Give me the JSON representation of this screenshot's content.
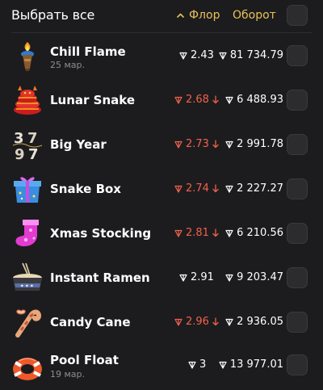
{
  "header": {
    "select_all_label": "Выбрать все",
    "sort_floor_label": "Флор",
    "sort_volume_label": "Оборот"
  },
  "colors": {
    "background": "#1c1c1e",
    "accent": "#e7c15a",
    "down": "#f0614b",
    "text": "#ffffff",
    "muted": "#8e8e93"
  },
  "rows": [
    {
      "name": "Chill Flame",
      "date": "25 мар.",
      "floor": "2.43",
      "floor_trend": "none",
      "volume": "81 734.79",
      "icon": "chill-flame-icon"
    },
    {
      "name": "Lunar Snake",
      "date": "",
      "floor": "2.68",
      "floor_trend": "down",
      "volume": "6 488.93",
      "icon": "lunar-snake-icon"
    },
    {
      "name": "Big Year",
      "date": "",
      "floor": "2.73",
      "floor_trend": "down",
      "volume": "2 991.78",
      "icon": "big-year-icon"
    },
    {
      "name": "Snake Box",
      "date": "",
      "floor": "2.74",
      "floor_trend": "down",
      "volume": "2 227.27",
      "icon": "snake-box-icon"
    },
    {
      "name": "Xmas Stocking",
      "date": "",
      "floor": "2.81",
      "floor_trend": "down",
      "volume": "6 210.56",
      "icon": "xmas-stocking-icon"
    },
    {
      "name": "Instant Ramen",
      "date": "",
      "floor": "2.91",
      "floor_trend": "none",
      "volume": "9 203.47",
      "icon": "instant-ramen-icon"
    },
    {
      "name": "Candy Cane",
      "date": "",
      "floor": "2.96",
      "floor_trend": "down",
      "volume": "2 936.05",
      "icon": "candy-cane-icon"
    },
    {
      "name": "Pool Float",
      "date": "19 мар.",
      "floor": "3",
      "floor_trend": "none",
      "volume": "13 977.01",
      "icon": "pool-float-icon"
    }
  ]
}
